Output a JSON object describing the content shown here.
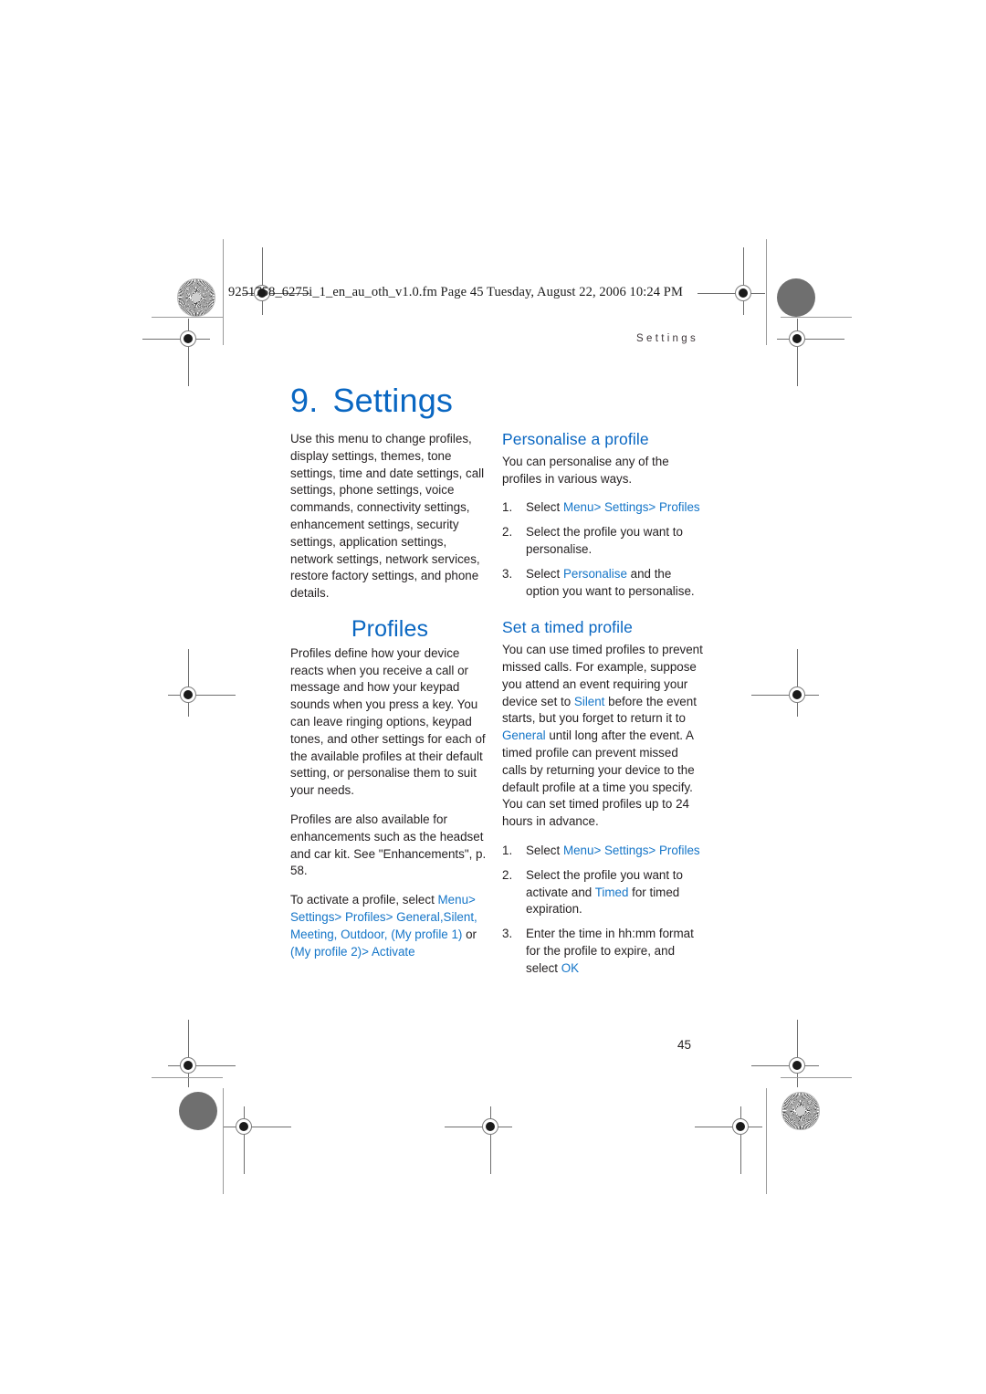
{
  "page": {
    "filename_line": "9251758_6275i_1_en_au_oth_v1.0.fm  Page 45  Tuesday, August 22, 2006  10:24 PM",
    "running_head": "Settings",
    "folio": "45",
    "accent_color": "#0a67c2",
    "link_color": "#1475c8",
    "text_color": "#231f20"
  },
  "chapter": {
    "number": "9.",
    "title": "Settings"
  },
  "left_column": {
    "intro": "Use this menu to change profiles, display settings, themes, tone settings, time and date settings, call settings, phone settings, voice commands, connectivity settings, enhancement settings, security settings, application settings, network settings, network services, restore factory settings, and phone details.",
    "profiles_heading": "Profiles",
    "profiles_p1": "Profiles define how your device reacts when you receive a call or message and how your keypad sounds when you press a key. You can leave ringing options, keypad tones, and other settings for each of the available profiles at their default setting, or personalise them to suit your needs.",
    "profiles_p2": "Profiles are also available for enhancements such as the headset and car kit. See \"Enhancements\", p. 58.",
    "activate_lead": "To activate a profile, select ",
    "activate_path": {
      "menu": "Menu",
      "settings": "Settings",
      "profiles": "Profiles",
      "general": "General",
      "silent": "Silent",
      "meeting": "Meeting",
      "outdoor": "Outdoor",
      "my_profile_1": "(My profile 1)",
      "or": "or ",
      "my_profile_2": "(My profile 2)",
      "activate": "Activate",
      "separator": ">",
      "comma": ","
    }
  },
  "right_column": {
    "personalise_heading": "Personalise a profile",
    "personalise_intro": "You can personalise any of the profiles in various ways.",
    "personalise_steps": [
      {
        "lead": "Select ",
        "path": [
          "Menu",
          "Settings",
          "Profiles"
        ],
        "tail": ""
      },
      {
        "lead": "Select the profile you want to personalise.",
        "path": [],
        "tail": ""
      },
      {
        "lead": "Select ",
        "path": [
          "Personalise"
        ],
        "tail": " and the option you want to personalise."
      }
    ],
    "timed_heading": "Set a timed profile",
    "timed_p1_a": "You can use timed profiles to prevent missed calls. For example, suppose you attend an event requiring your device set to ",
    "timed_p1_silent": "Silent",
    "timed_p1_b": " before the event starts, but you forget to return it to ",
    "timed_p1_general": "General",
    "timed_p1_c": " until long after the event. A timed profile can prevent missed calls by returning your device to the default profile at a time you specify. You can set timed profiles up to 24 hours in advance.",
    "timed_steps": [
      {
        "lead": "Select ",
        "path": [
          "Menu",
          "Settings",
          "Profiles"
        ],
        "tail": ""
      },
      {
        "lead": "Select the profile you want to activate and ",
        "path": [
          "Timed"
        ],
        "tail": " for timed expiration."
      },
      {
        "lead": "Enter the time in hh:mm format for the profile to expire, and select ",
        "path": [
          "OK"
        ],
        "tail": ""
      }
    ]
  }
}
